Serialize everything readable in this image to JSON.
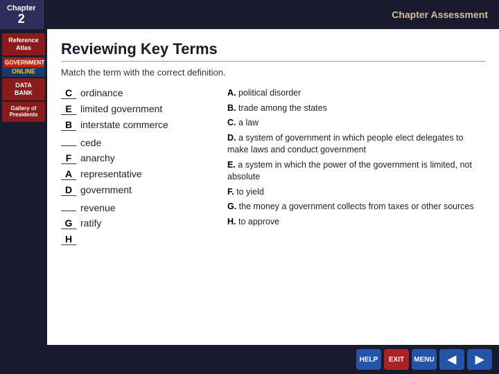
{
  "topBar": {
    "chapter_label": "Chapter",
    "chapter_number": "2",
    "assessment_label": "Chapter Assessment"
  },
  "sidebar": {
    "items": [
      {
        "id": "reference-atlas",
        "label": "Reference\nAtlas"
      },
      {
        "id": "gov-online",
        "label": "GOVERNMENT\nONLINE"
      },
      {
        "id": "data-bank",
        "label": "DATA\nBANK"
      },
      {
        "id": "gallery",
        "label": "Gallery of\nPresidents"
      }
    ]
  },
  "main": {
    "title": "Reviewing Key Terms",
    "subtitle": "Match the term with the correct definition.",
    "terms": [
      {
        "blank": "C",
        "term": "ordinance"
      },
      {
        "blank": "E",
        "term": "limited government"
      },
      {
        "blank": "B",
        "term": "interstate commerce"
      },
      {
        "blank": "",
        "term": "cede"
      },
      {
        "blank": "F",
        "term": "anarchy"
      },
      {
        "blank": "A",
        "term": "representative"
      },
      {
        "blank": "D",
        "term": "government"
      },
      {
        "blank": "",
        "term": "revenue"
      },
      {
        "blank": "G",
        "term": "ratify"
      },
      {
        "blank": "H",
        "term": ""
      }
    ],
    "definitions": [
      {
        "letter": "A.",
        "text": "political disorder"
      },
      {
        "letter": "B.",
        "text": "trade among the states"
      },
      {
        "letter": "C.",
        "text": "a law"
      },
      {
        "letter": "D.",
        "text": "a system of government in which people elect delegates to make laws and conduct government"
      },
      {
        "letter": "E.",
        "text": "a system in which the power of the government is limited, not absolute"
      },
      {
        "letter": "F.",
        "text": "to yield"
      },
      {
        "letter": "G.",
        "text": "the money a government collects from taxes or other sources"
      },
      {
        "letter": "H.",
        "text": "to approve"
      }
    ]
  },
  "bottomBar": {
    "help": "HELP",
    "exit": "EXIT",
    "menu": "MENU",
    "back": "◀",
    "forward": "▶"
  }
}
